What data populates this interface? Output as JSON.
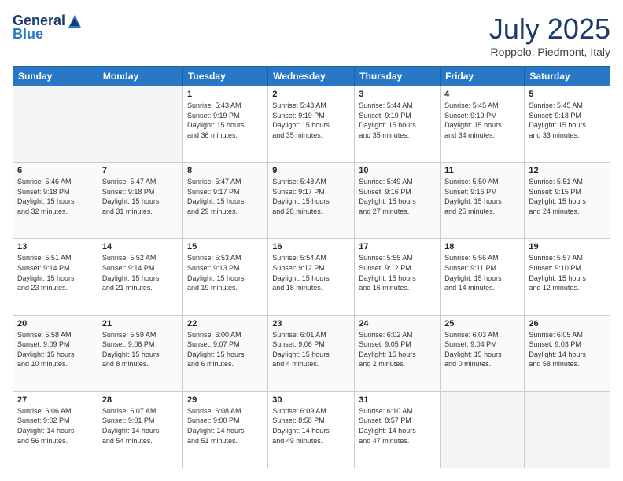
{
  "header": {
    "logo": {
      "general": "General",
      "blue": "Blue"
    },
    "title": "July 2025",
    "location": "Roppolo, Piedmont, Italy"
  },
  "weekdays": [
    "Sunday",
    "Monday",
    "Tuesday",
    "Wednesday",
    "Thursday",
    "Friday",
    "Saturday"
  ],
  "weeks": [
    [
      {
        "day": "",
        "info": ""
      },
      {
        "day": "",
        "info": ""
      },
      {
        "day": "1",
        "info": "Sunrise: 5:43 AM\nSunset: 9:19 PM\nDaylight: 15 hours\nand 36 minutes."
      },
      {
        "day": "2",
        "info": "Sunrise: 5:43 AM\nSunset: 9:19 PM\nDaylight: 15 hours\nand 35 minutes."
      },
      {
        "day": "3",
        "info": "Sunrise: 5:44 AM\nSunset: 9:19 PM\nDaylight: 15 hours\nand 35 minutes."
      },
      {
        "day": "4",
        "info": "Sunrise: 5:45 AM\nSunset: 9:19 PM\nDaylight: 15 hours\nand 34 minutes."
      },
      {
        "day": "5",
        "info": "Sunrise: 5:45 AM\nSunset: 9:18 PM\nDaylight: 15 hours\nand 33 minutes."
      }
    ],
    [
      {
        "day": "6",
        "info": "Sunrise: 5:46 AM\nSunset: 9:18 PM\nDaylight: 15 hours\nand 32 minutes."
      },
      {
        "day": "7",
        "info": "Sunrise: 5:47 AM\nSunset: 9:18 PM\nDaylight: 15 hours\nand 31 minutes."
      },
      {
        "day": "8",
        "info": "Sunrise: 5:47 AM\nSunset: 9:17 PM\nDaylight: 15 hours\nand 29 minutes."
      },
      {
        "day": "9",
        "info": "Sunrise: 5:48 AM\nSunset: 9:17 PM\nDaylight: 15 hours\nand 28 minutes."
      },
      {
        "day": "10",
        "info": "Sunrise: 5:49 AM\nSunset: 9:16 PM\nDaylight: 15 hours\nand 27 minutes."
      },
      {
        "day": "11",
        "info": "Sunrise: 5:50 AM\nSunset: 9:16 PM\nDaylight: 15 hours\nand 25 minutes."
      },
      {
        "day": "12",
        "info": "Sunrise: 5:51 AM\nSunset: 9:15 PM\nDaylight: 15 hours\nand 24 minutes."
      }
    ],
    [
      {
        "day": "13",
        "info": "Sunrise: 5:51 AM\nSunset: 9:14 PM\nDaylight: 15 hours\nand 23 minutes."
      },
      {
        "day": "14",
        "info": "Sunrise: 5:52 AM\nSunset: 9:14 PM\nDaylight: 15 hours\nand 21 minutes."
      },
      {
        "day": "15",
        "info": "Sunrise: 5:53 AM\nSunset: 9:13 PM\nDaylight: 15 hours\nand 19 minutes."
      },
      {
        "day": "16",
        "info": "Sunrise: 5:54 AM\nSunset: 9:12 PM\nDaylight: 15 hours\nand 18 minutes."
      },
      {
        "day": "17",
        "info": "Sunrise: 5:55 AM\nSunset: 9:12 PM\nDaylight: 15 hours\nand 16 minutes."
      },
      {
        "day": "18",
        "info": "Sunrise: 5:56 AM\nSunset: 9:11 PM\nDaylight: 15 hours\nand 14 minutes."
      },
      {
        "day": "19",
        "info": "Sunrise: 5:57 AM\nSunset: 9:10 PM\nDaylight: 15 hours\nand 12 minutes."
      }
    ],
    [
      {
        "day": "20",
        "info": "Sunrise: 5:58 AM\nSunset: 9:09 PM\nDaylight: 15 hours\nand 10 minutes."
      },
      {
        "day": "21",
        "info": "Sunrise: 5:59 AM\nSunset: 9:08 PM\nDaylight: 15 hours\nand 8 minutes."
      },
      {
        "day": "22",
        "info": "Sunrise: 6:00 AM\nSunset: 9:07 PM\nDaylight: 15 hours\nand 6 minutes."
      },
      {
        "day": "23",
        "info": "Sunrise: 6:01 AM\nSunset: 9:06 PM\nDaylight: 15 hours\nand 4 minutes."
      },
      {
        "day": "24",
        "info": "Sunrise: 6:02 AM\nSunset: 9:05 PM\nDaylight: 15 hours\nand 2 minutes."
      },
      {
        "day": "25",
        "info": "Sunrise: 6:03 AM\nSunset: 9:04 PM\nDaylight: 15 hours\nand 0 minutes."
      },
      {
        "day": "26",
        "info": "Sunrise: 6:05 AM\nSunset: 9:03 PM\nDaylight: 14 hours\nand 58 minutes."
      }
    ],
    [
      {
        "day": "27",
        "info": "Sunrise: 6:06 AM\nSunset: 9:02 PM\nDaylight: 14 hours\nand 56 minutes."
      },
      {
        "day": "28",
        "info": "Sunrise: 6:07 AM\nSunset: 9:01 PM\nDaylight: 14 hours\nand 54 minutes."
      },
      {
        "day": "29",
        "info": "Sunrise: 6:08 AM\nSunset: 9:00 PM\nDaylight: 14 hours\nand 51 minutes."
      },
      {
        "day": "30",
        "info": "Sunrise: 6:09 AM\nSunset: 8:58 PM\nDaylight: 14 hours\nand 49 minutes."
      },
      {
        "day": "31",
        "info": "Sunrise: 6:10 AM\nSunset: 8:57 PM\nDaylight: 14 hours\nand 47 minutes."
      },
      {
        "day": "",
        "info": ""
      },
      {
        "day": "",
        "info": ""
      }
    ]
  ]
}
